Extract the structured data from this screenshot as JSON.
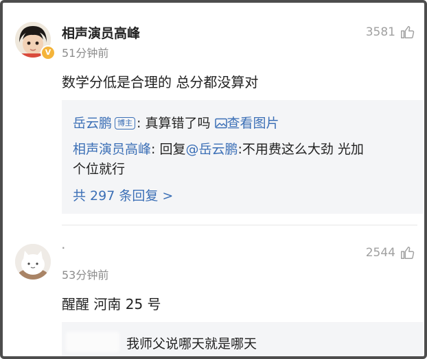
{
  "comment1": {
    "username": "相声演员高峰",
    "time": "51分钟前",
    "likes": "3581",
    "text": "数学分低是合理的 总分都没算对",
    "replies": {
      "r1_user": "岳云鹏",
      "r1_badge": "博主",
      "r1_text": ": 真算错了吗",
      "r1_link": "查看图片",
      "r2_user": "相声演员高峰",
      "r2_text_a": ": 回复",
      "r2_mention": "@岳云鹏",
      "r2_text_b": ":不用费这么大劲 光加",
      "r2_text_c": "个位就行",
      "more": "共 297 条回复 >"
    }
  },
  "comment2": {
    "username": ".",
    "time": "53分钟前",
    "likes": "2544",
    "text": "醒醒 河南 25 号",
    "reply_preview": "我师父说哪天就是哪天"
  },
  "icons": {
    "like": "thumbs-up-icon",
    "image": "image-icon",
    "verified": "verified-badge-icon"
  },
  "colors": {
    "link_blue": "#3b6fb6",
    "reply_bg": "#f4f5f7",
    "verified_gold": "#f4b43a"
  }
}
